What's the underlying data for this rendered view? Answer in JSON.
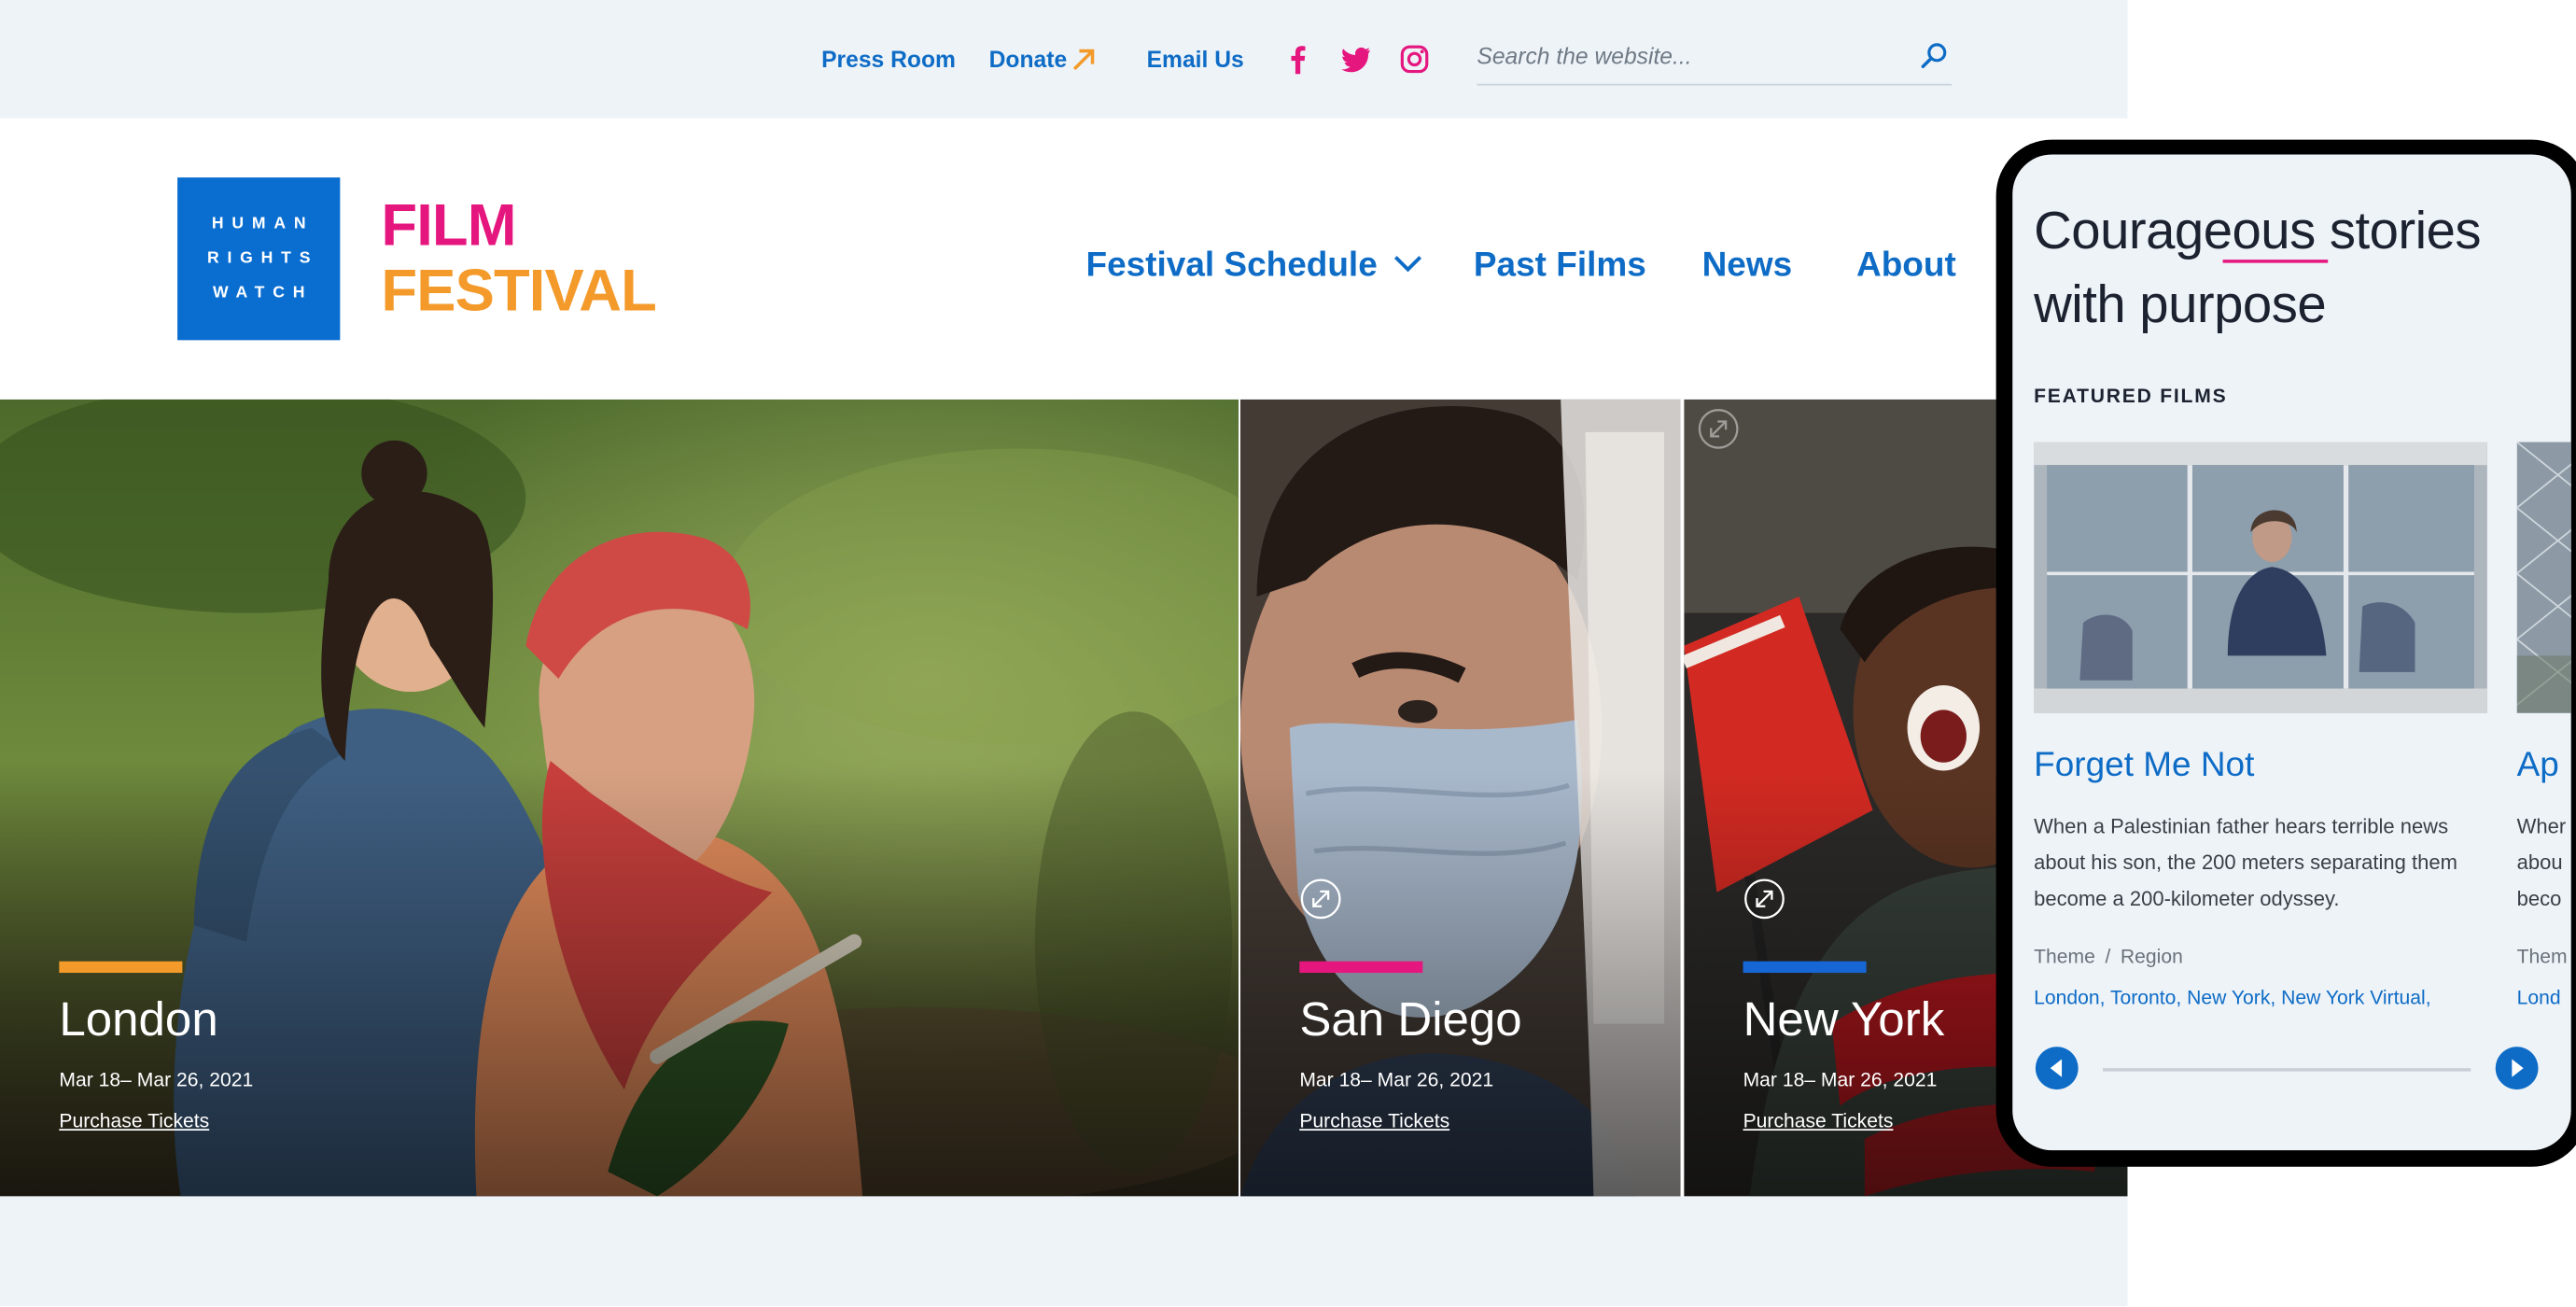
{
  "utility_nav": {
    "press_room": "Press Room",
    "donate": "Donate",
    "email_us": "Email Us",
    "search_placeholder": "Search the website..."
  },
  "brand": {
    "logo_lines": [
      "HUMAN",
      "RIGHTS",
      "WATCH"
    ],
    "title_line1": "FILM",
    "title_line2": "FESTIVAL"
  },
  "main_nav": {
    "festival_schedule": "Festival Schedule",
    "past_films": "Past Films",
    "news": "News",
    "about": "About"
  },
  "hero": {
    "panels": [
      {
        "city": "London",
        "dates": "Mar 18– Mar 26, 2021",
        "cta": "Purchase Tickets"
      },
      {
        "city": "San Diego",
        "dates": "Mar 18– Mar 26, 2021",
        "cta": "Purchase Tickets"
      },
      {
        "city": "New York",
        "dates": "Mar 18– Mar 26, 2021",
        "cta": "Purchase Tickets"
      }
    ]
  },
  "mobile": {
    "headline_line1": "Courageous stories",
    "headline_line2": "with purpose",
    "section_label": "FEATURED FILMS",
    "cards": [
      {
        "title": "Forget Me Not",
        "description": "When a Palestinian father hears terrible news about his son, the 200 meters separating them become a 200-kilometer odyssey.",
        "theme": "Theme",
        "sep": "/",
        "region": "Region",
        "cities": "London, Toronto, New York, New York Virtual,"
      },
      {
        "title": "Ap",
        "desc_lines": [
          "Wher",
          "abou",
          "beco"
        ],
        "theme": "Them",
        "cities": "Lond"
      }
    ]
  },
  "colors": {
    "primary_blue": "#0e6cc6",
    "logo_blue": "#0a6ed1",
    "magenta": "#e5177f",
    "orange": "#f39a2b",
    "page_bg": "#eef3f8"
  },
  "icons": [
    "external-arrow-icon",
    "facebook-icon",
    "twitter-icon",
    "instagram-icon",
    "search-icon",
    "chevron-down-icon",
    "expand-icon",
    "arrow-left-icon",
    "arrow-right-icon"
  ]
}
